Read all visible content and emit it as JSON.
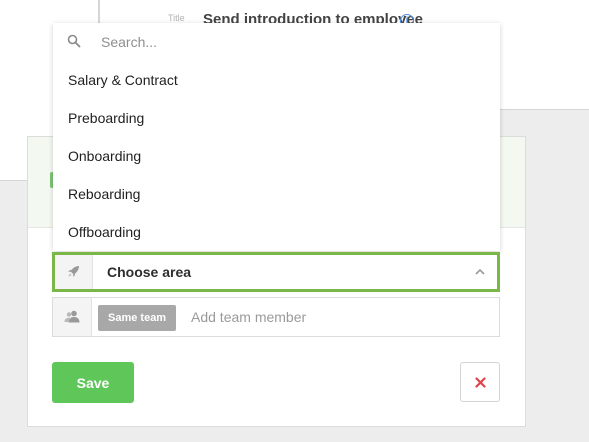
{
  "background": {
    "peek_label": "Title",
    "peek_text": "Send introduction to employee",
    "peek_info_glyph": "i"
  },
  "dropdown": {
    "search_placeholder": "Search...",
    "search_value": "",
    "options": [
      {
        "label": "Salary & Contract"
      },
      {
        "label": "Preboarding"
      },
      {
        "label": "Onboarding"
      },
      {
        "label": "Reboarding"
      },
      {
        "label": "Offboarding"
      }
    ]
  },
  "area_select": {
    "label": "Choose area",
    "icon": "rocket-icon",
    "expanded": true
  },
  "team_field": {
    "chip_label": "Same team",
    "placeholder": "Add team member",
    "value": "",
    "icon": "users-icon"
  },
  "actions": {
    "save_label": "Save",
    "cancel_icon": "close-icon"
  },
  "colors": {
    "accent_green": "#5fc75a",
    "focus_border": "#7ab648",
    "danger_red": "#e0434b",
    "chip_gray": "#a8a8a8",
    "info_blue": "#4a90e2"
  }
}
